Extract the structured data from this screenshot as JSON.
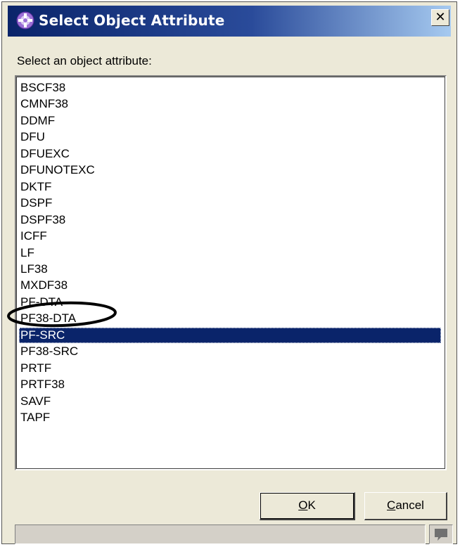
{
  "window": {
    "title": "Select Object Attribute",
    "close_glyph": "✕",
    "title_gradient_start": "#0a246a",
    "title_gradient_end": "#a6caf0",
    "app_icon": "eclipse-plus-icon"
  },
  "prompt": "Select an object attribute:",
  "list": {
    "items": [
      "BSCF38",
      "CMNF38",
      "DDMF",
      "DFU",
      "DFUEXC",
      "DFUNOTEXC",
      "DKTF",
      "DSPF",
      "DSPF38",
      "ICFF",
      "LF",
      "LF38",
      "MXDF38",
      "PF-DTA",
      "PF38-DTA",
      "PF-SRC",
      "PF38-SRC",
      "PRTF",
      "PRTF38",
      "SAVF",
      "TAPF"
    ],
    "selected": "PF-SRC",
    "selection_color": "#0a246a"
  },
  "buttons": {
    "ok": {
      "access_key": "O",
      "rest": "K"
    },
    "cancel": {
      "access_key": "C",
      "rest": "ancel"
    }
  },
  "status": {
    "icon": "speech-bubble-icon"
  }
}
